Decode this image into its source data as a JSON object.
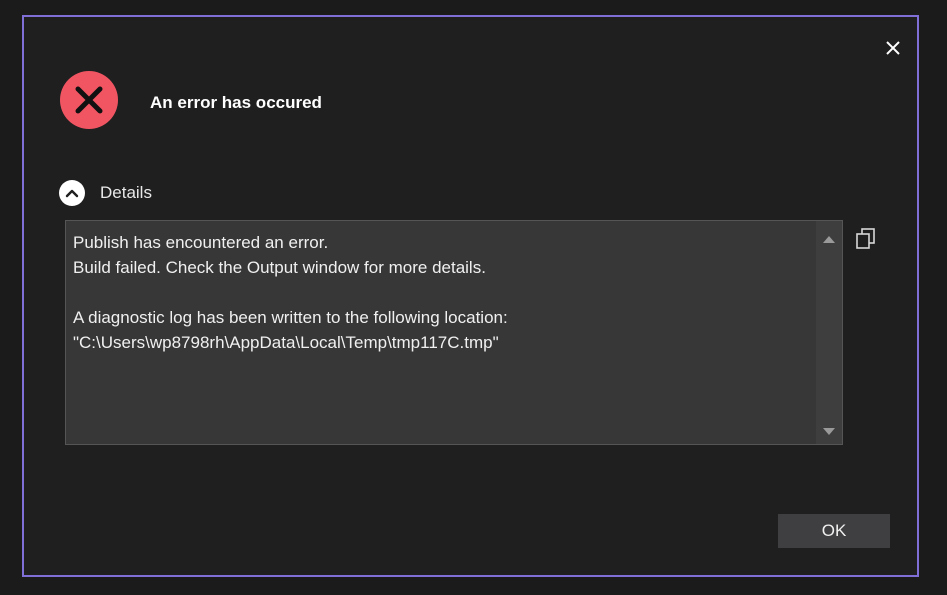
{
  "dialog": {
    "title": "An error has occured",
    "accent_color": "#7f6fd6",
    "error_color": "#f25562",
    "close_icon": "close-icon",
    "status_icon": "error-x-icon"
  },
  "details": {
    "toggle_label": "Details",
    "toggle_icon": "chevron-up-icon",
    "lines": [
      "Publish has encountered an error.",
      "Build failed. Check the Output window for more details.",
      "",
      "A diagnostic log has been written to the following location:",
      "\"C:\\Users\\wp8798rh\\AppData\\Local\\Temp\\tmp117C.tmp\""
    ],
    "copy_icon": "copy-icon"
  },
  "buttons": {
    "ok_label": "OK"
  }
}
